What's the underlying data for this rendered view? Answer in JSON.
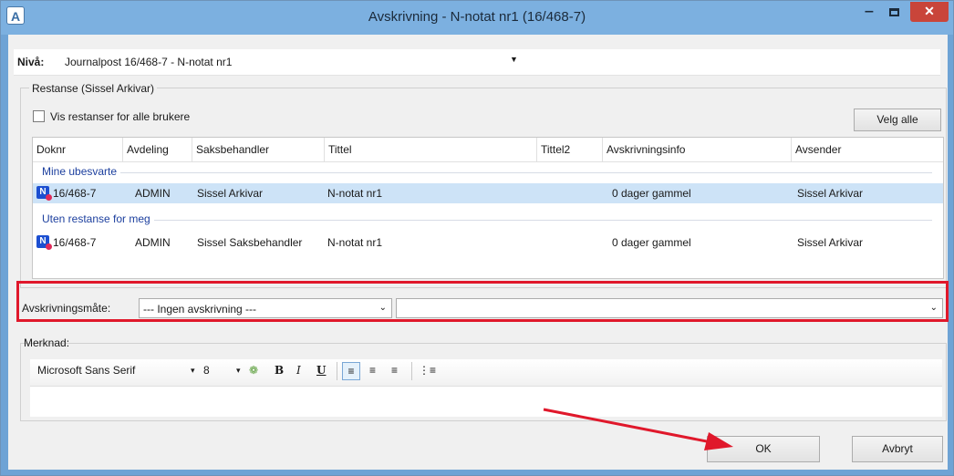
{
  "window": {
    "title": "Avskrivning - N-notat nr1 (16/468-7)",
    "app_icon_letter": "A",
    "minimize": "‒",
    "close": "✕"
  },
  "niva": {
    "label": "Nivå:",
    "value": "Journalpost 16/468-7 - N-notat nr1"
  },
  "restanse": {
    "group_title": "Restanse (Sissel Arkivar)",
    "checkbox_label": "Vis restanser for alle brukere",
    "checkbox_checked": false,
    "select_all_button": "Velg alle",
    "columns": [
      "Doknr",
      "Avdeling",
      "Saksbehandler",
      "Tittel",
      "Tittel2",
      "Avskrivningsinfo",
      "Avsender"
    ],
    "groups": [
      {
        "label": "Mine ubesvarte",
        "rows": [
          {
            "doknr": "16/468-7",
            "avdeling": "ADMIN",
            "saksbehandler": "Sissel Arkivar",
            "tittel": "N-notat nr1",
            "tittel2": "",
            "info": "0 dager gammel",
            "avsender": "Sissel Arkivar",
            "selected": true
          }
        ]
      },
      {
        "label": "Uten restanse for meg",
        "rows": [
          {
            "doknr": "16/468-7",
            "avdeling": "ADMIN",
            "saksbehandler": "Sissel Saksbehandler",
            "tittel": "N-notat nr1",
            "tittel2": "",
            "info": "0 dager gammel",
            "avsender": "Sissel Arkivar",
            "selected": false
          }
        ]
      }
    ]
  },
  "avskrivning": {
    "label": "Avskrivningsmåte:",
    "mode_value": "--- Ingen avskrivning ---",
    "second_value": ""
  },
  "merknad": {
    "label": "Merknad:",
    "font_name": "Microsoft Sans Serif",
    "font_size": "8",
    "bold": "B",
    "italic": "I",
    "underline": "U"
  },
  "buttons": {
    "ok": "OK",
    "cancel": "Avbryt"
  },
  "colors": {
    "title_bar": "#7cb0e0",
    "close_button": "#c9453a",
    "selection": "#cde3f7",
    "highlight_box": "#e0182b",
    "group_label": "#1c3f9e"
  }
}
